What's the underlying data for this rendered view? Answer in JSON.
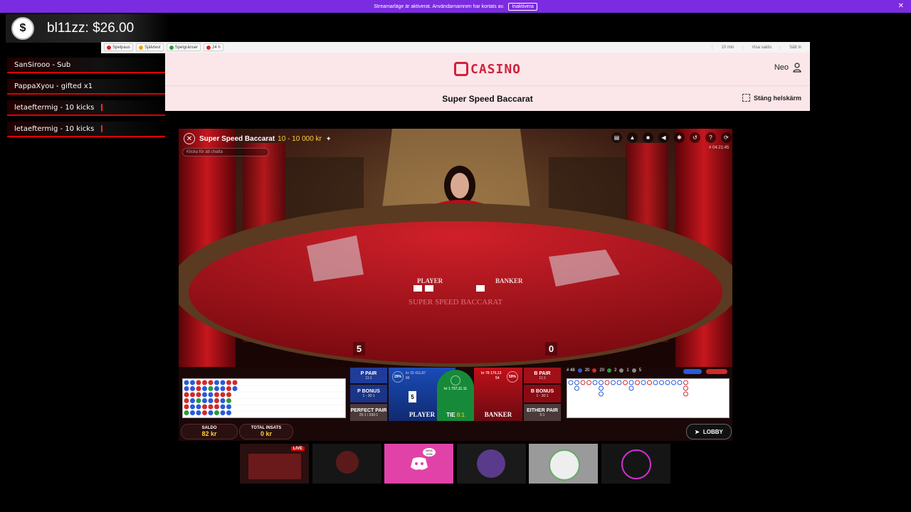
{
  "banner": {
    "text": "Streamarläge är aktiverat. Användarnamnen har kortats av.",
    "button": "Inaktivera",
    "close": "✕"
  },
  "stream": {
    "balance": "bl11zz: $26.00",
    "alerts": [
      {
        "text": "SanSirooo - Sub"
      },
      {
        "text": "PappaXyou - gifted x1"
      },
      {
        "text": "letaeftermig - 10 kicks"
      },
      {
        "text": "letaeftermig - 10 kicks"
      }
    ]
  },
  "topbar": {
    "chips": [
      {
        "label": "Spelpaus",
        "color": "#d22"
      },
      {
        "label": "Självtest",
        "color": "#e9a400"
      },
      {
        "label": "Spelgränser",
        "color": "#2a9b3c"
      },
      {
        "label": "24 h",
        "color": "#d22"
      }
    ],
    "timer": "10 min",
    "show_balance": "Visa saldo",
    "deposit": "Sätt in"
  },
  "casino": {
    "logo": "CASINO",
    "user": "Neo",
    "game_title": "Super Speed Baccarat",
    "fullscreen": "Stäng helskärm"
  },
  "game": {
    "title": "Super Speed Baccarat",
    "limits": "10 - 10 000 kr",
    "chat_placeholder": "Klicka för att chatta",
    "round_id": "# 04:21:45",
    "player_score": "5",
    "banker_score": "0",
    "table_text_player": "PLAYER",
    "table_text_banker": "BANKER",
    "table_logo": "SUPER SPEED BACCARAT"
  },
  "bets": {
    "p_pair": "P PAIR",
    "p_pair_odds": "11:1",
    "p_bonus": "P BONUS",
    "p_bonus_odds": "1 - 30:1",
    "perfect_pair": "PERFECT PAIR",
    "perfect_pair_odds": "25:1 / 200:1",
    "player": "PLAYER",
    "player_card": "5",
    "player_stats": "kr 33 411,87",
    "player_count": "86",
    "player_pct": "29%",
    "tie": "TIE",
    "tie_odds": "8:1",
    "tie_stats": "kr 1 757,11",
    "tie_count": "11",
    "banker": "BANKER",
    "banker_stats": "kr 78 170,13",
    "banker_count": "54",
    "banker_pct": "59%",
    "b_pair": "B PAIR",
    "b_pair_odds": "11:1",
    "b_bonus": "B BONUS",
    "b_bonus_odds": "1 - 30:1",
    "either_pair": "EITHER PAIR",
    "either_pair_odds": "5:1"
  },
  "stats": {
    "rounds": "# 48",
    "p": "20",
    "b": "20",
    "t": "2",
    "pp": "1",
    "bp": "5"
  },
  "footer": {
    "saldo_label": "SALDO",
    "saldo_value": "82 kr",
    "insats_label": "TOTAL INSATS",
    "insats_value": "0 kr",
    "lobby": "LOBBY"
  },
  "thumbs": {
    "live": "LIVE",
    "discord_badge": "BIRA JOIN"
  }
}
